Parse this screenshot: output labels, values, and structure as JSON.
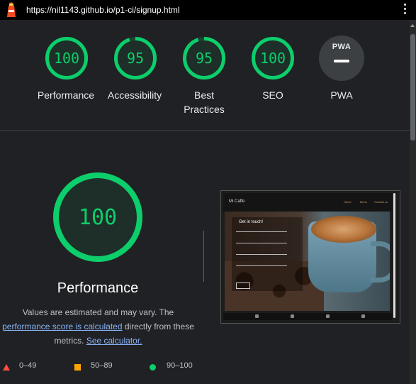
{
  "header": {
    "url": "https://nil1143.github.io/p1-ci/signup.html"
  },
  "scores": [
    {
      "label_lines": [
        "Performance"
      ],
      "score": "100",
      "fraction": 1.0
    },
    {
      "label_lines": [
        "Accessibility"
      ],
      "score": "95",
      "fraction": 0.95
    },
    {
      "label_lines": [
        "Best",
        "Practices"
      ],
      "score": "95",
      "fraction": 0.95
    },
    {
      "label_lines": [
        "SEO"
      ],
      "score": "100",
      "fraction": 1.0
    }
  ],
  "pwa": {
    "badge_text": "PWA",
    "label": "PWA"
  },
  "performance": {
    "score": "100",
    "fraction": 1.0,
    "title": "Performance",
    "desc_prefix": "Values are estimated and may vary. The ",
    "desc_link": "performance score is calculated",
    "desc_middle": " directly from these metrics. ",
    "calc_link": "See calculator."
  },
  "preview": {
    "logo": "Mi Caffe",
    "menu": [
      "Home",
      "Menu",
      "Contact us"
    ],
    "form_title": "Get in touch!"
  },
  "legend": [
    {
      "range": "0–49",
      "color": "#ff4e42"
    },
    {
      "range": "50–89",
      "color": "#ffa400"
    },
    {
      "range": "90–100",
      "color": "#0cce6b"
    }
  ],
  "colors": {
    "pass": "#0cce6b",
    "link": "#8ab4f8",
    "background": "#202124"
  }
}
